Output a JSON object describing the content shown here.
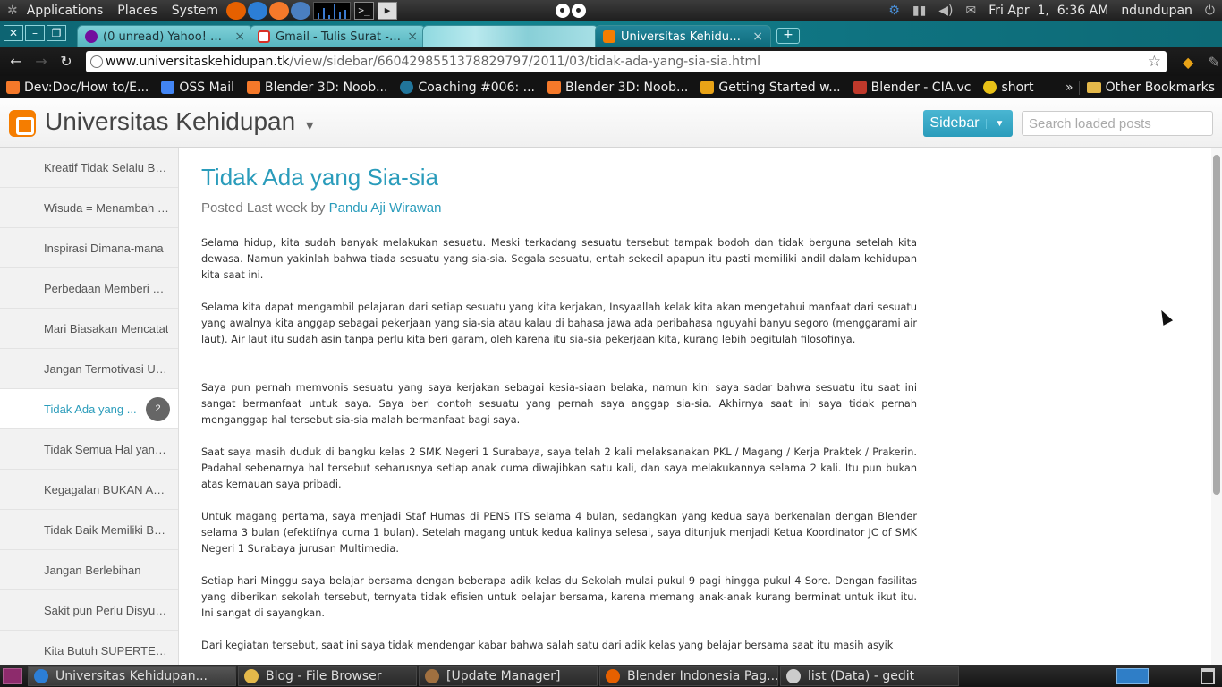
{
  "top_panel": {
    "menus": [
      "Applications",
      "Places",
      "System"
    ],
    "launchers": [
      "firefox-icon",
      "chrome-icon",
      "blender-icon",
      "thunderbird-icon"
    ],
    "launcher_colors": [
      "#e66000",
      "#2c7ed6",
      "#f5792a",
      "#4a7fc1"
    ],
    "clock": "Fri Apr  1,  6:36 AM",
    "user": "ndundupan"
  },
  "tabs": [
    {
      "title": "(0 unread) Yahoo! Ma...",
      "favicon": "yahoo-icon",
      "active": false
    },
    {
      "title": "Gmail - Tulis Surat - n...",
      "favicon": "gmail-icon",
      "active": false
    },
    {
      "title": "",
      "favicon": "",
      "active": false
    },
    {
      "title": "Universitas Kehidupan",
      "favicon": "blogger-icon",
      "active": true
    }
  ],
  "toolbar": {
    "url_host": "www.universitaskehidupan.tk",
    "url_path": "/view/sidebar/6604298551378829797/2011/03/tidak-ada-yang-sia-sia.html"
  },
  "bookmarks": {
    "items": [
      {
        "label": "Dev:Doc/How to/E...",
        "icon": "blender-icon",
        "color": "#f5792a"
      },
      {
        "label": "OSS Mail",
        "icon": "google-icon",
        "color": "#4285f4"
      },
      {
        "label": "Blender 3D: Noob...",
        "icon": "blender-icon",
        "color": "#f5792a"
      },
      {
        "label": "Coaching #006: ...",
        "icon": "wordpress-icon",
        "color": "#21759b"
      },
      {
        "label": "Blender 3D: Noob...",
        "icon": "blender-icon",
        "color": "#f5792a"
      },
      {
        "label": "Getting Started w...",
        "icon": "doc-icon",
        "color": "#e8a317"
      },
      {
        "label": "Blender - CIA.vc",
        "icon": "cia-icon",
        "color": "#c0392b"
      },
      {
        "label": "short",
        "icon": "bee-icon",
        "color": "#e8c117"
      }
    ],
    "more": "»",
    "other": "Other Bookmarks"
  },
  "blog": {
    "title": "Universitas Kehidupan",
    "view_button": "Sidebar",
    "search_placeholder": "Search loaded posts"
  },
  "sidebar": {
    "items": [
      {
        "label": "Kreatif Tidak Selalu Ba...",
        "active": false
      },
      {
        "label": "Wisuda = Menambah P...",
        "active": false
      },
      {
        "label": "Inspirasi Dimana-mana",
        "active": false
      },
      {
        "label": "Perbedaan Memberi Ke...",
        "active": false
      },
      {
        "label": "Mari Biasakan Mencatat",
        "active": false
      },
      {
        "label": "Jangan Termotivasi Uang",
        "active": false
      },
      {
        "label": "Tidak Ada yang ...",
        "active": true,
        "count": "2"
      },
      {
        "label": "Tidak Semua Hal yang ...",
        "active": false
      },
      {
        "label": "Kegagalan BUKAN Akh...",
        "active": false
      },
      {
        "label": "Tidak Baik Memiliki Ba...",
        "active": false
      },
      {
        "label": "Jangan Berlebihan",
        "active": false
      },
      {
        "label": "Sakit pun Perlu Disyukuri",
        "active": false
      },
      {
        "label": "Kita Butuh SUPERTEA...",
        "active": false
      }
    ]
  },
  "post": {
    "title": "Tidak Ada yang Sia-sia",
    "meta_prefix": "Posted Last week by ",
    "author": "Pandu Aji Wirawan",
    "paragraphs": [
      "Selama hidup, kita sudah banyak melakukan sesuatu. Meski terkadang sesuatu tersebut tampak bodoh dan tidak berguna setelah kita dewasa. Namun yakinlah bahwa tiada sesuatu yang sia-sia. Segala sesuatu, entah sekecil apapun itu pasti memiliki andil dalam kehidupan kita saat ini.",
      "Selama kita dapat mengambil pelajaran dari setiap sesuatu yang kita kerjakan, Insyaallah kelak kita akan mengetahui manfaat dari sesuatu yang awalnya kita anggap sebagai pekerjaan yang sia-sia atau kalau di bahasa jawa ada peribahasa nguyahi banyu segoro (menggarami air laut). Air laut itu sudah asin tanpa perlu kita beri garam, oleh karena itu sia-sia pekerjaan kita, kurang lebih begitulah filosofinya.",
      "Saya pun pernah memvonis sesuatu yang saya kerjakan sebagai kesia-siaan belaka, namun kini saya sadar bahwa sesuatu itu saat ini sangat bermanfaat untuk saya. Saya beri contoh sesuatu yang pernah saya anggap sia-sia. Akhirnya saat ini saya tidak pernah menganggap hal tersebut sia-sia malah bermanfaat bagi saya.",
      "Saat saya masih duduk di bangku kelas 2 SMK Negeri 1 Surabaya, saya telah 2 kali melaksanakan PKL / Magang / Kerja Praktek / Prakerin. Padahal sebenarnya hal tersebut seharusnya setiap anak cuma diwajibkan satu kali, dan saya melakukannya selama 2 kali. Itu pun bukan atas kemauan saya pribadi.",
      "Untuk magang pertama, saya menjadi Staf Humas di PENS ITS selama 4 bulan, sedangkan yang kedua saya berkenalan dengan Blender selama 3 bulan (efektifnya cuma 1 bulan). Setelah magang untuk kedua kalinya selesai, saya ditunjuk menjadi Ketua Koordinator JC of SMK Negeri 1 Surabaya jurusan Multimedia.",
      "Setiap hari Minggu saya belajar bersama dengan beberapa adik kelas du Sekolah mulai pukul 9 pagi hingga pukul 4 Sore. Dengan fasilitas yang diberikan sekolah tersebut, ternyata tidak efisien untuk belajar bersama, karena memang anak-anak kurang berminat untuk ikut itu. Ini sangat di sayangkan.",
      "Dari kegiatan tersebut, saat ini saya tidak mendengar kabar bahwa salah satu dari adik kelas yang belajar bersama saat itu masih asyik"
    ]
  },
  "taskbar": {
    "tasks": [
      {
        "label": "Universitas Kehidupan...",
        "icon": "chrome-icon",
        "color": "#2c7ed6",
        "active": true
      },
      {
        "label": "Blog - File Browser",
        "icon": "folder-icon",
        "color": "#e4b84a",
        "active": false
      },
      {
        "label": "[Update Manager]",
        "icon": "package-icon",
        "color": "#a07040",
        "active": false
      },
      {
        "label": "Blender Indonesia Pag...",
        "icon": "firefox-icon",
        "color": "#e66000",
        "active": false
      },
      {
        "label": "list (Data) - gedit",
        "icon": "gedit-icon",
        "color": "#cccccc",
        "active": false
      }
    ]
  },
  "colors": {
    "accent": "#2a9cbb",
    "blogger_orange": "#f57d00",
    "tabstrip": "#12838f"
  }
}
